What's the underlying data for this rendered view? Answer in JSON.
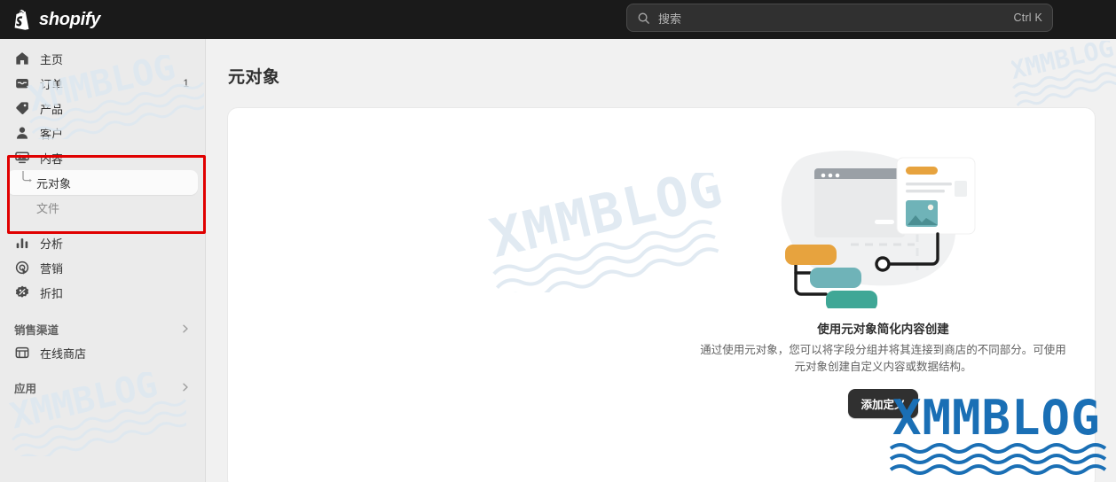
{
  "topbar": {
    "brand_name": "shopify",
    "brand_icon": "shopify-bag-icon",
    "search": {
      "icon": "search-icon",
      "placeholder": "搜索",
      "shortcut": "Ctrl K"
    }
  },
  "sidebar": {
    "items": [
      {
        "label": "主页",
        "icon": "home-icon",
        "badge": ""
      },
      {
        "label": "订单",
        "icon": "orders-inbox-icon",
        "badge": "1"
      },
      {
        "label": "产品",
        "icon": "product-tag-icon",
        "badge": ""
      },
      {
        "label": "客户",
        "icon": "customer-person-icon",
        "badge": ""
      },
      {
        "label": "内容",
        "icon": "content-media-icon",
        "badge": ""
      }
    ],
    "content_children": [
      {
        "label": "元对象",
        "selected": true
      },
      {
        "label": "文件",
        "selected": false
      }
    ],
    "items_lower": [
      {
        "label": "分析",
        "icon": "analytics-bars-icon"
      },
      {
        "label": "营销",
        "icon": "marketing-target-icon"
      },
      {
        "label": "折扣",
        "icon": "discount-badge-icon"
      }
    ],
    "sections": [
      {
        "title": "销售渠道",
        "chevron": "chevron-right-icon"
      },
      {
        "title": "应用",
        "chevron": "chevron-right-icon"
      }
    ],
    "sales_channels": [
      {
        "label": "在线商店",
        "icon": "online-store-icon"
      }
    ]
  },
  "main": {
    "page_title": "元对象",
    "empty_state": {
      "illustration": "metaobjects-illustration",
      "title": "使用元对象简化内容创建",
      "description": "通过使用元对象，您可以将字段分组并将其连接到商店的不同部分。可使用元对象创建自定义内容或数据结构。",
      "cta_label": "添加定义"
    }
  },
  "annotation": {
    "highlight_box_color": "#e00000",
    "highlight_target": "内容"
  },
  "watermarks": {
    "text": "XMMBLOG",
    "light_color": "#dce7f0",
    "bold_color": "#1a6fb5"
  },
  "colors": {
    "topbar_bg": "#1a1a1a",
    "sidebar_bg": "#ebebeb",
    "page_bg": "#f1f1f1",
    "card_bg": "#ffffff",
    "text_primary": "#303030",
    "text_muted": "#616161",
    "accent_orange": "#e7a33e",
    "accent_teal": "#6fb3b8",
    "accent_green": "#4aa99a"
  }
}
